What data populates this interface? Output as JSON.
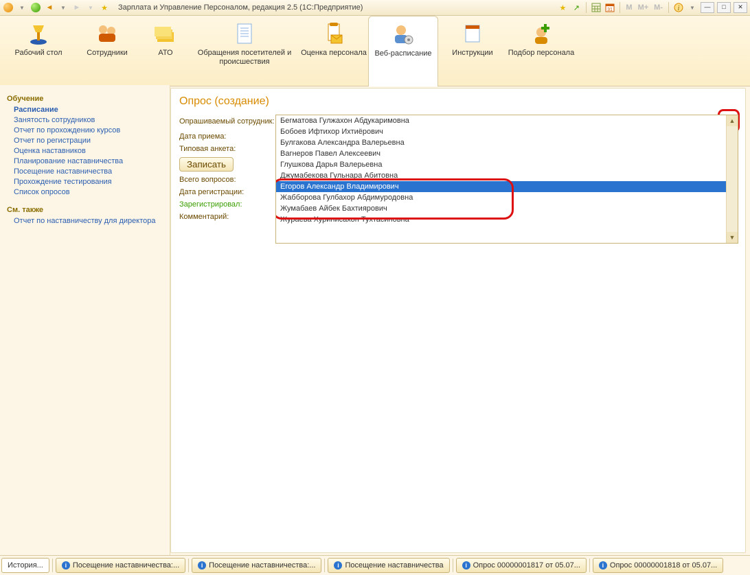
{
  "titlebar": {
    "title": "Зарплата и Управление Персоналом, редакция 2.5  (1С:Предприятие)"
  },
  "toolbar": {
    "items": [
      {
        "label": "Рабочий стол"
      },
      {
        "label": "Сотрудники"
      },
      {
        "label": "АТО"
      },
      {
        "label": "Обращения посетителей и происшествия"
      },
      {
        "label": "Оценка персонала"
      },
      {
        "label": "Веб-расписание"
      },
      {
        "label": "Инструкции"
      },
      {
        "label": "Подбор персонала"
      }
    ]
  },
  "sidebar": {
    "section1": "Обучение",
    "links": [
      "Расписание",
      "Занятость сотрудников",
      "Отчет по прохождению курсов",
      "Отчет по регистрации",
      "Оценка наставников",
      "Планирование наставничества",
      "Посещение наставничества",
      "Прохождение тестирования",
      "Список опросов"
    ],
    "section2": "См. также",
    "links2": [
      "Отчет по наставничеству для директора"
    ]
  },
  "page": {
    "title": "Опрос (создание)",
    "labels": {
      "employee": "Опрашиваемый сотрудник:",
      "hire_date": "Дата приема:",
      "template": "Типовая анкета:",
      "save_btn": "Записать",
      "total_q": "Всего вопросов:",
      "reg_date": "Дата регистрации:",
      "registered_by": "Зарегистрировал:",
      "comment": "Комментарий:"
    }
  },
  "dropdown": {
    "items": [
      "Бегматова Гулжахон Абдукаримовна",
      "Бобоев Ифтихор Ихтиёрович",
      "Булгакова Александра Валерьевна",
      "Вагнеров Павел Алексеевич",
      "Глушкова Дарья Валерьевна",
      "Джумабекова Гульнара Абитовна",
      "Егоров Александр Владимирович",
      "Жабборова Гулбахор Абдимуродовна",
      "Жумабаев Айбек Бахтиярович",
      "Жураева Хуринисахон Тухтасиновна"
    ],
    "selected_index": 6
  },
  "taskbar": {
    "history": "История...",
    "tabs": [
      "Посещение наставничества:...",
      "Посещение наставничества:...",
      "Посещение наставничества",
      "Опрос 00000001817 от 05.07...",
      "Опрос 00000001818 от 05.07..."
    ]
  },
  "titlebar_letters": {
    "m": "M",
    "mp": "M+",
    "mm": "M-"
  }
}
